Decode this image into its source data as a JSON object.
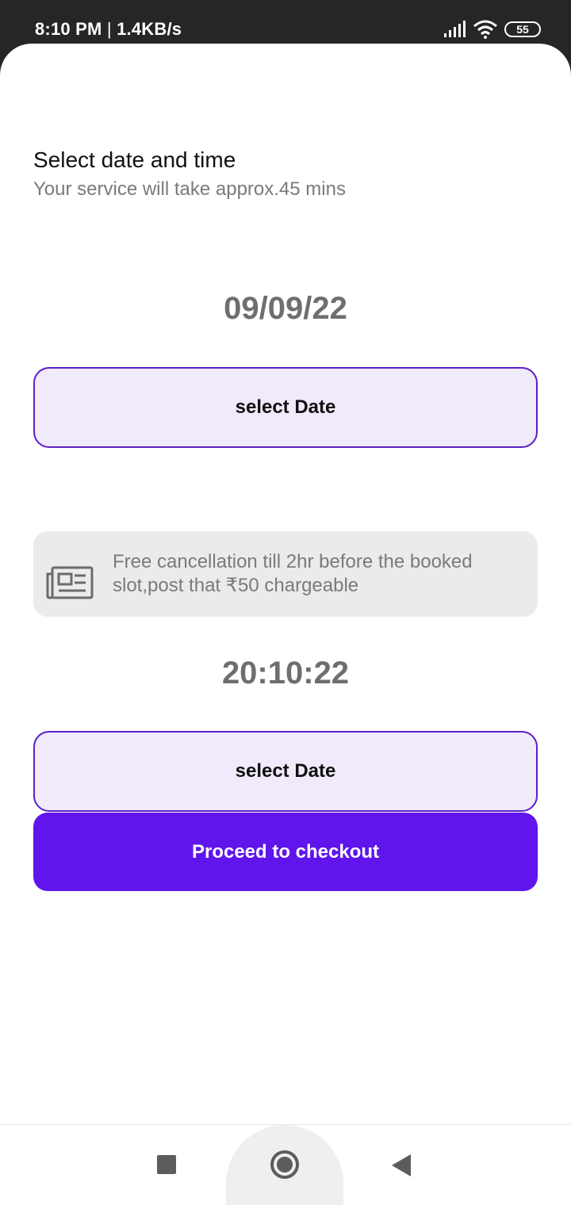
{
  "status_bar": {
    "time": "8:10 PM",
    "speed": "1.4KB/s",
    "battery": "55",
    "icons": [
      "signal-icon",
      "wifi-icon",
      "battery-icon"
    ]
  },
  "header": {
    "title": "Select date and time",
    "subtitle": "Your service will take approx.45 mins"
  },
  "date": {
    "value": "09/09/22",
    "button_label": "select Date"
  },
  "notice": {
    "icon": "newspaper-icon",
    "text": "Free cancellation till 2hr before the booked slot,post that ₹50 chargeable"
  },
  "time": {
    "value": "20:10:22",
    "button_label": "select Date"
  },
  "checkout": {
    "label": "Proceed to checkout"
  },
  "nav_bar": {
    "icons": [
      "recents-icon",
      "home-icon",
      "back-icon"
    ]
  },
  "colors": {
    "accent": "#5f15ec",
    "button_border": "#5b1fc7",
    "button_fill": "#f1eafb",
    "notice_bg": "#ebebeb"
  }
}
